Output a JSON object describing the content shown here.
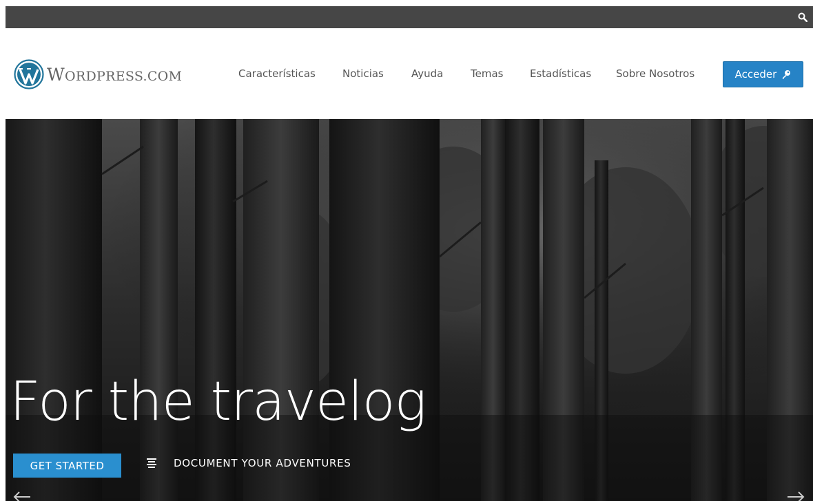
{
  "topbar": {
    "search_icon": "search-icon"
  },
  "header": {
    "logo_text": "WordPress.com",
    "logo_icon": "wordpress-logo-icon",
    "nav": [
      {
        "label": "Características"
      },
      {
        "label": "Noticias"
      },
      {
        "label": "Ayuda"
      },
      {
        "label": "Temas"
      },
      {
        "label": "Estadísticas"
      },
      {
        "label": "Sobre Nosotros"
      }
    ],
    "login_label": "Acceder",
    "login_icon": "key-icon"
  },
  "hero": {
    "title": "For the travelog",
    "cta_label": "GET STARTED",
    "caption": "DOCUMENT YOUR ADVENTURES",
    "caption_icon": "text-post-icon",
    "prev_icon": "arrow-left-icon",
    "next_icon": "arrow-right-icon"
  },
  "colors": {
    "topbar": "#464646",
    "accent": "#2683c6",
    "cta": "#2a8fcf",
    "logo_blue": "#21759b",
    "nav_text": "#555555"
  }
}
